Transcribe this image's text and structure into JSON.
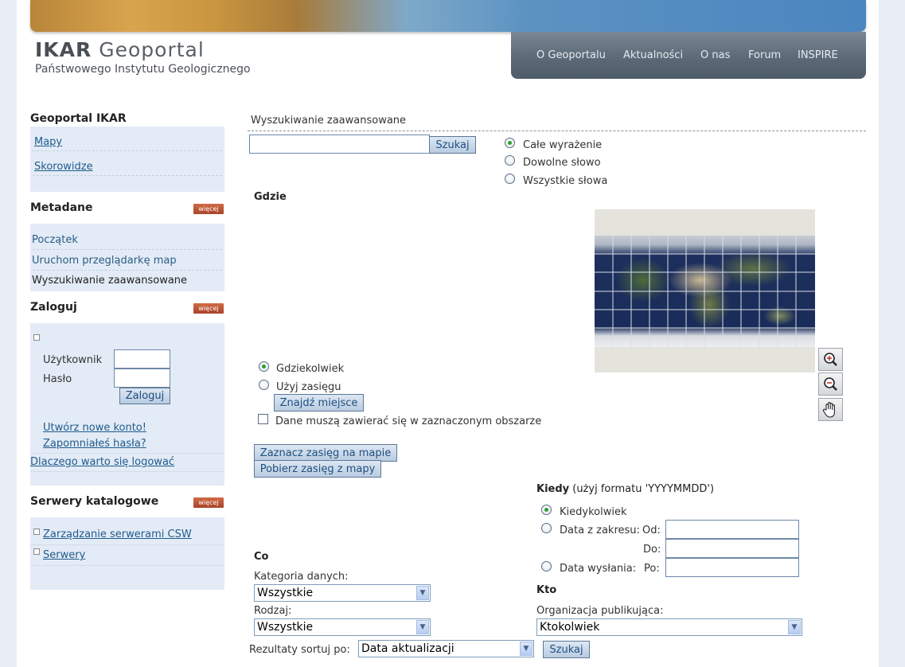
{
  "logo": {
    "brand": "IKAR",
    "name": "Geoportal",
    "subtitle": "Państwowego Instytutu Geologicznego"
  },
  "topnav": [
    "O Geoportalu",
    "Aktualności",
    "O nas",
    "Forum",
    "INSPIRE"
  ],
  "sidebar": {
    "more_label": "więcej",
    "geoportal": {
      "title": "Geoportal IKAR",
      "links": [
        "Mapy",
        "Skorowidze"
      ]
    },
    "metadata": {
      "title": "Metadane",
      "links": [
        "Początek",
        "Uruchom przeglądarkę map",
        "Wyszukiwanie zaawansowane"
      ]
    },
    "login": {
      "title": "Zaloguj",
      "user_label": "Użytkownik",
      "password_label": "Hasło",
      "user_value": "",
      "password_value": "",
      "login_button": "Zaloguj",
      "create_account": "Utwórz nowe konto!",
      "forgot_password": "Zapomniałeś hasła?",
      "why_login": "Dlaczego warto się logować"
    },
    "catalog": {
      "title": "Serwery katalogowe",
      "links": [
        "Zarządzanie serwerami CSW",
        "Serwery"
      ]
    }
  },
  "search": {
    "title": "Wyszukiwanie zaawansowane",
    "query_value": "",
    "search_button": "Szukaj",
    "match_options": [
      "Całe wyrażenie",
      "Dowolne słowo",
      "Wszystkie słowa"
    ],
    "match_selected": "Całe wyrażenie"
  },
  "where": {
    "title": "Gdzie",
    "options": [
      "Gdziekolwiek",
      "Użyj zasięgu"
    ],
    "selected": "Gdziekolwiek",
    "find_place_button": "Znajdź miejsce",
    "contained_label": "Dane muszą zawierać się w zaznaczonym obszarze",
    "contained_checked": false,
    "mark_extent_button": "Zaznacz zasięg na mapie",
    "get_extent_button": "Pobierz zasięg z mapy",
    "map_tools": [
      "zoom-in-icon",
      "zoom-out-icon",
      "pan-hand-icon"
    ]
  },
  "when": {
    "title": "Kiedy",
    "hint": "(użyj formatu 'YYYYMMDD')",
    "options": [
      "Kiedykolwiek",
      "Data z zakresu:",
      "Data wysłania:"
    ],
    "selected": "Kiedykolwiek",
    "from_label": "Od:",
    "to_label": "Do:",
    "sent_label": "Po:",
    "from_value": "",
    "to_value": "",
    "sent_value": ""
  },
  "what": {
    "title": "Co",
    "category_label": "Kategoria danych:",
    "category_value": "Wszystkie",
    "type_label": "Rodzaj:",
    "type_value": "Wszystkie"
  },
  "who": {
    "title": "Kto",
    "org_label": "Organizacja publikująca:",
    "org_value": "Ktokolwiek"
  },
  "sort": {
    "label": "Rezultaty sortuj po:",
    "value": "Data aktualizacji",
    "search_button": "Szukaj"
  }
}
